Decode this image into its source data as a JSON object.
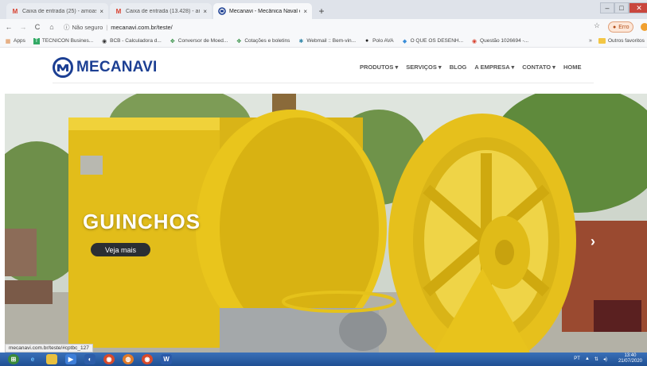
{
  "browser": {
    "tabs": [
      {
        "title": "Caixa de entrada (25) - amoasor...",
        "icon": "gmail-icon",
        "active": false
      },
      {
        "title": "Caixa de entrada (13.428) - amo...",
        "icon": "gmail-icon",
        "active": false
      },
      {
        "title": "Mecanavi - Mecânica Naval e In...",
        "icon": "mecanavi-icon",
        "active": true
      }
    ],
    "tab_close": "×",
    "new_tab": "+",
    "address": {
      "security": "Não seguro",
      "url": "mecanavi.com.br/teste/"
    },
    "profile_label": "Erro",
    "bookmarks": [
      {
        "label": "Apps",
        "icon": "apps-grid-icon"
      },
      {
        "label": "TECNICON Busines...",
        "icon": "tecnicon-icon"
      },
      {
        "label": "BCB - Calculadora d...",
        "icon": "bcb-icon"
      },
      {
        "label": "Conversor de Moed...",
        "icon": "currency-icon"
      },
      {
        "label": "Cotações e boletins",
        "icon": "quotes-icon"
      },
      {
        "label": "Webmail :: Bem-vin...",
        "icon": "webmail-icon"
      },
      {
        "label": "Polo AVA",
        "icon": "polo-icon"
      },
      {
        "label": "O QUE OS DESENH...",
        "icon": "bookmark-icon"
      },
      {
        "label": "Questão 1026694 -...",
        "icon": "question-icon"
      }
    ],
    "bookmarks_more": "»",
    "other_bookmarks": "Outros favoritos",
    "status_url": "mecanavi.com.br/teste/#cptbc_127"
  },
  "site": {
    "logo_text": "MECANAVI",
    "nav": [
      "PRODUTOS ▾",
      "SERVIÇOS ▾",
      "BLOG",
      "A EMPRESA ▾",
      "CONTATO ▾",
      "HOME"
    ],
    "hero": {
      "title": "GUINCHOS",
      "button": "Veja mais",
      "next_arrow": "›"
    }
  },
  "taskbar": {
    "lang": "PT",
    "time": "13:40",
    "date": "21/07/2020"
  },
  "colors": {
    "brand": "#1c3f93",
    "machine_yellow": "#e9c51c",
    "taskbar": "#1f4f93"
  }
}
